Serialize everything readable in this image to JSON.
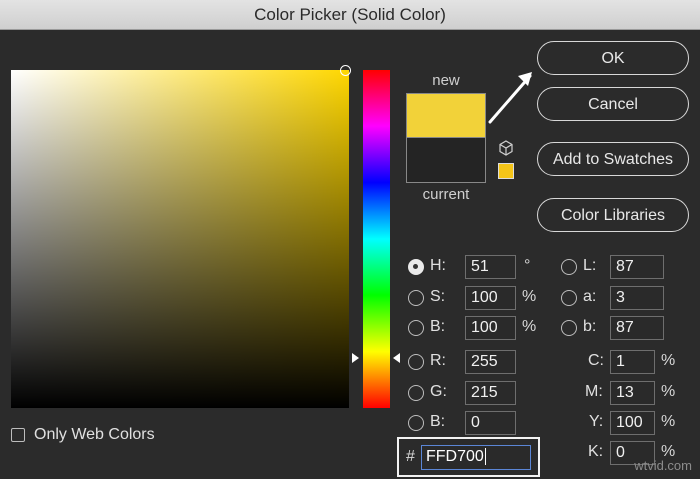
{
  "window": {
    "title": "Color Picker (Solid Color)"
  },
  "preview": {
    "new_label": "new",
    "current_label": "current",
    "new_color": "#f2d239",
    "current_color": "#242424",
    "websafe_color": "#f5c518"
  },
  "buttons": {
    "ok": "OK",
    "cancel": "Cancel",
    "add_to_swatches": "Add to Swatches",
    "color_libraries": "Color Libraries"
  },
  "hsb": [
    {
      "label": "H:",
      "value": "51",
      "unit": "°",
      "selected": true
    },
    {
      "label": "S:",
      "value": "100",
      "unit": "%",
      "selected": false
    },
    {
      "label": "B:",
      "value": "100",
      "unit": "%",
      "selected": false
    }
  ],
  "rgb": [
    {
      "label": "R:",
      "value": "255"
    },
    {
      "label": "G:",
      "value": "215"
    },
    {
      "label": "B:",
      "value": "0"
    }
  ],
  "lab": [
    {
      "label": "L:",
      "value": "87"
    },
    {
      "label": "a:",
      "value": "3"
    },
    {
      "label": "b:",
      "value": "87"
    }
  ],
  "cmyk": [
    {
      "label": "C:",
      "value": "1",
      "unit": "%"
    },
    {
      "label": "M:",
      "value": "13",
      "unit": "%"
    },
    {
      "label": "Y:",
      "value": "100",
      "unit": "%"
    },
    {
      "label": "K:",
      "value": "0",
      "unit": "%"
    }
  ],
  "hex": {
    "symbol": "#",
    "value": "FFD700"
  },
  "only_web_colors": {
    "label": "Only Web Colors",
    "checked": false
  },
  "watermark": "wtvid.com"
}
